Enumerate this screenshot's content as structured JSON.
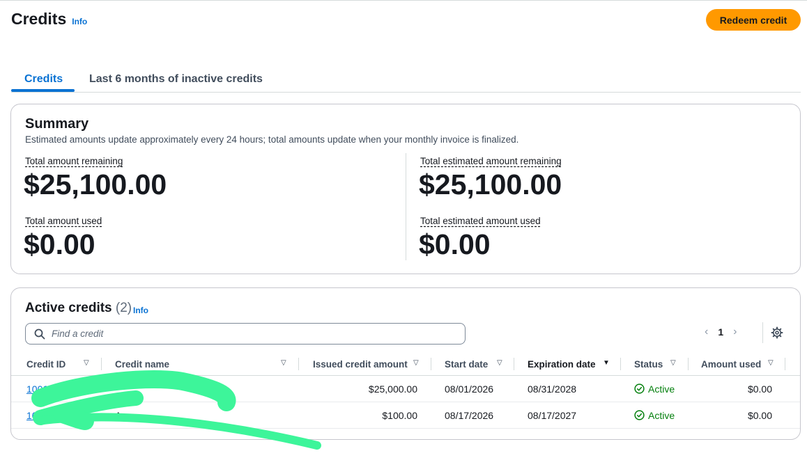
{
  "header": {
    "title": "Credits",
    "info_label": "Info",
    "redeem_label": "Redeem credit"
  },
  "tabs": [
    {
      "label": "Credits",
      "active": true
    },
    {
      "label": "Last 6 months of inactive credits",
      "active": false
    }
  ],
  "summary": {
    "title": "Summary",
    "description": "Estimated amounts update approximately every 24 hours; total amounts update when your monthly invoice is finalized.",
    "metrics": [
      {
        "label": "Total amount remaining",
        "value": "$25,100.00"
      },
      {
        "label": "Total estimated amount remaining",
        "value": "$25,100.00"
      },
      {
        "label": "Total amount used",
        "value": "$0.00"
      },
      {
        "label": "Total estimated amount used",
        "value": "$0.00"
      }
    ]
  },
  "active_credits": {
    "title": "Active credits",
    "count": "(2)",
    "info_label": "Info",
    "search_placeholder": "Find a credit",
    "page": "1",
    "columns": [
      "Credit ID",
      "Credit name",
      "Issued credit amount",
      "Start date",
      "Expiration date",
      "Status",
      "Amount used"
    ],
    "rows": [
      {
        "credit_id": "10066",
        "credit_name": "",
        "issued": "$25,000.00",
        "start": "08/01/2026",
        "expiration": "08/31/2028",
        "status": "Active",
        "used": "$0.00"
      },
      {
        "credit_id": "100",
        "credit_name": "Aw",
        "issued": "$100.00",
        "start": "08/17/2026",
        "expiration": "08/17/2027",
        "status": "Active",
        "used": "$0.00"
      }
    ]
  },
  "colors": {
    "accent": "#0972d3",
    "button": "#ff9900",
    "status_active": "#037f0c",
    "redaction": "#3df59a"
  }
}
